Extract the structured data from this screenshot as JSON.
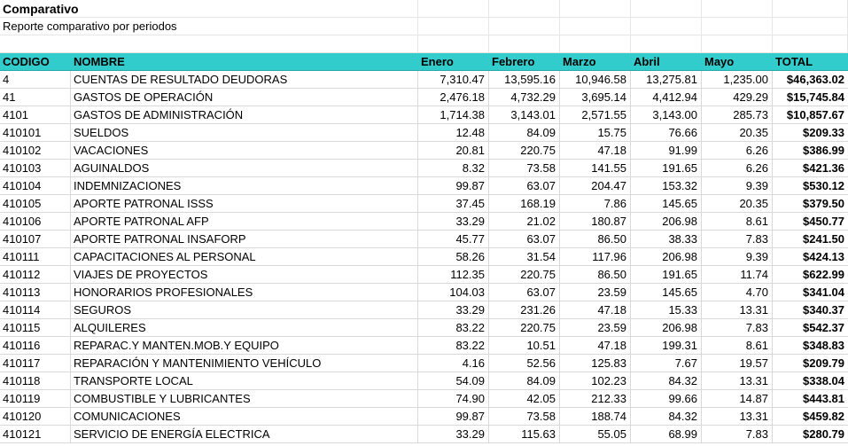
{
  "report": {
    "title": "Comparativo",
    "subtitle": "Reporte comparativo por periodos"
  },
  "colors": {
    "header_bg": "#33cccc",
    "grid_line": "#d9d9d9"
  },
  "table": {
    "headers": [
      "CODIGO",
      "NOMBRE",
      "Enero",
      "Febrero",
      "Marzo",
      "Abril",
      "Mayo",
      "TOTAL"
    ],
    "rows": [
      [
        "4",
        "CUENTAS DE RESULTADO DEUDORAS",
        "7,310.47",
        "13,595.16",
        "10,946.58",
        "13,275.81",
        "1,235.00",
        "$46,363.02"
      ],
      [
        "41",
        "GASTOS DE OPERACIÓN",
        "2,476.18",
        "4,732.29",
        "3,695.14",
        "4,412.94",
        "429.29",
        "$15,745.84"
      ],
      [
        "4101",
        "GASTOS DE ADMINISTRACIÓN",
        "1,714.38",
        "3,143.01",
        "2,571.55",
        "3,143.00",
        "285.73",
        "$10,857.67"
      ],
      [
        "410101",
        "SUELDOS",
        "12.48",
        "84.09",
        "15.75",
        "76.66",
        "20.35",
        "$209.33"
      ],
      [
        "410102",
        "VACACIONES",
        "20.81",
        "220.75",
        "47.18",
        "91.99",
        "6.26",
        "$386.99"
      ],
      [
        "410103",
        "AGUINALDOS",
        "8.32",
        "73.58",
        "141.55",
        "191.65",
        "6.26",
        "$421.36"
      ],
      [
        "410104",
        "INDEMNIZACIONES",
        "99.87",
        "63.07",
        "204.47",
        "153.32",
        "9.39",
        "$530.12"
      ],
      [
        "410105",
        "APORTE PATRONAL ISSS",
        "37.45",
        "168.19",
        "7.86",
        "145.65",
        "20.35",
        "$379.50"
      ],
      [
        "410106",
        "APORTE PATRONAL AFP",
        "33.29",
        "21.02",
        "180.87",
        "206.98",
        "8.61",
        "$450.77"
      ],
      [
        "410107",
        "APORTE PATRONAL INSAFORP",
        "45.77",
        "63.07",
        "86.50",
        "38.33",
        "7.83",
        "$241.50"
      ],
      [
        "410111",
        "CAPACITACIONES AL PERSONAL",
        "58.26",
        "31.54",
        "117.96",
        "206.98",
        "9.39",
        "$424.13"
      ],
      [
        "410112",
        "VIAJES DE PROYECTOS",
        "112.35",
        "220.75",
        "86.50",
        "191.65",
        "11.74",
        "$622.99"
      ],
      [
        "410113",
        "HONORARIOS PROFESIONALES",
        "104.03",
        "63.07",
        "23.59",
        "145.65",
        "4.70",
        "$341.04"
      ],
      [
        "410114",
        "SEGUROS",
        "33.29",
        "231.26",
        "47.18",
        "15.33",
        "13.31",
        "$340.37"
      ],
      [
        "410115",
        "ALQUILERES",
        "83.22",
        "220.75",
        "23.59",
        "206.98",
        "7.83",
        "$542.37"
      ],
      [
        "410116",
        "REPARAC.Y MANTEN.MOB.Y EQUIPO",
        "83.22",
        "10.51",
        "47.18",
        "199.31",
        "8.61",
        "$348.83"
      ],
      [
        "410117",
        "REPARACIÓN Y MANTENIMIENTO VEHÍCULO",
        "4.16",
        "52.56",
        "125.83",
        "7.67",
        "19.57",
        "$209.79"
      ],
      [
        "410118",
        "TRANSPORTE LOCAL",
        "54.09",
        "84.09",
        "102.23",
        "84.32",
        "13.31",
        "$338.04"
      ],
      [
        "410119",
        "COMBUSTIBLE Y LUBRICANTES",
        "74.90",
        "42.05",
        "212.33",
        "99.66",
        "14.87",
        "$443.81"
      ],
      [
        "410120",
        "COMUNICACIONES",
        "99.87",
        "73.58",
        "188.74",
        "84.32",
        "13.31",
        "$459.82"
      ],
      [
        "410121",
        "SERVICIO DE ENERGÍA ELECTRICA",
        "33.29",
        "115.63",
        "55.05",
        "68.99",
        "7.83",
        "$280.79"
      ]
    ]
  }
}
